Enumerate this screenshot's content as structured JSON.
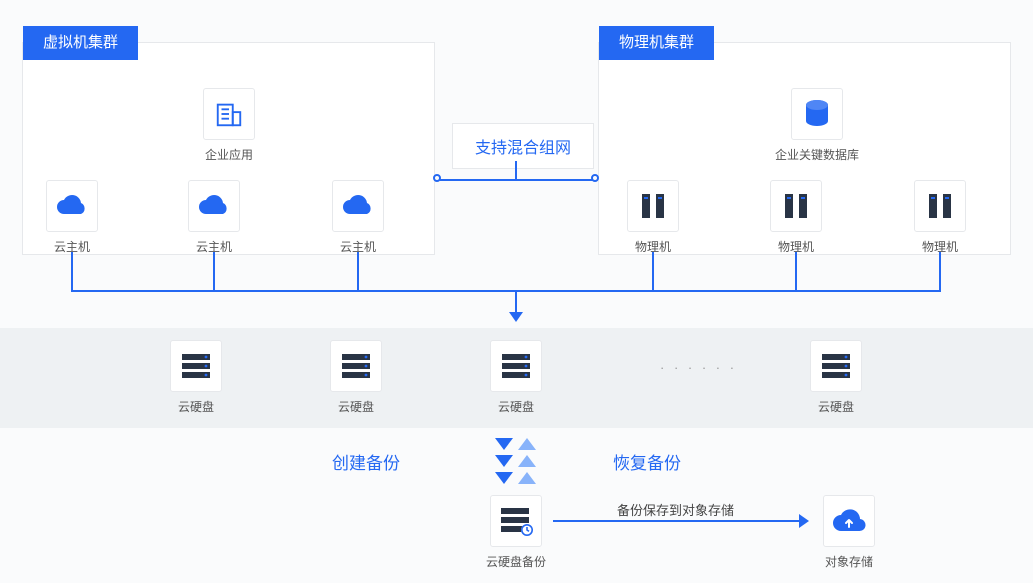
{
  "clusters": {
    "vm": {
      "title": "虚拟机集群",
      "app": "企业应用",
      "host": "云主机"
    },
    "pm": {
      "title": "物理机集群",
      "db": "企业关键数据库",
      "host": "物理机"
    }
  },
  "mixed_networking": "支持混合组网",
  "disks": {
    "label": "云硬盘",
    "ellipsis": "· · · · · ·"
  },
  "actions": {
    "create_backup": "创建备份",
    "restore_backup": "恢复备份",
    "save_to_obj": "备份保存到对象存储"
  },
  "backup_node": "云硬盘备份",
  "object_storage": "对象存储"
}
